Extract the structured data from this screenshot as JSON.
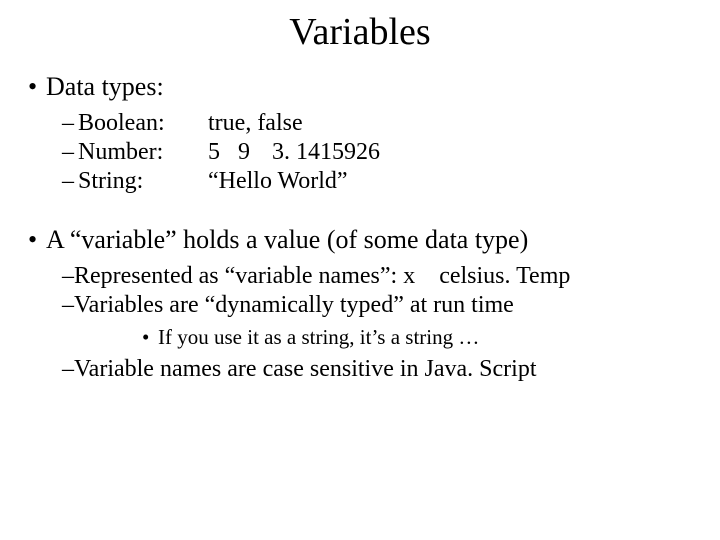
{
  "title": "Variables",
  "bullet1": "Data types:",
  "types": {
    "boolean_label": "Boolean:",
    "boolean_vals": "true, false",
    "number_label": "Number:",
    "number_v1": "5",
    "number_v2": "9",
    "number_v3": "3. 1415926",
    "string_label": "String:",
    "string_vals": "“Hello World”"
  },
  "bullet2": "A “variable” holds a value (of some data type)",
  "sub": {
    "repr_pre": "Represented as “variable names”: ",
    "repr_x": "x",
    "repr_gap": "    ",
    "repr_ct": "celsius. Temp",
    "dyn": "Variables are “dynamically typed” at run time",
    "use": "If you use it as a string, it’s a string …",
    "case": "Variable names are case sensitive in Java. Script"
  }
}
